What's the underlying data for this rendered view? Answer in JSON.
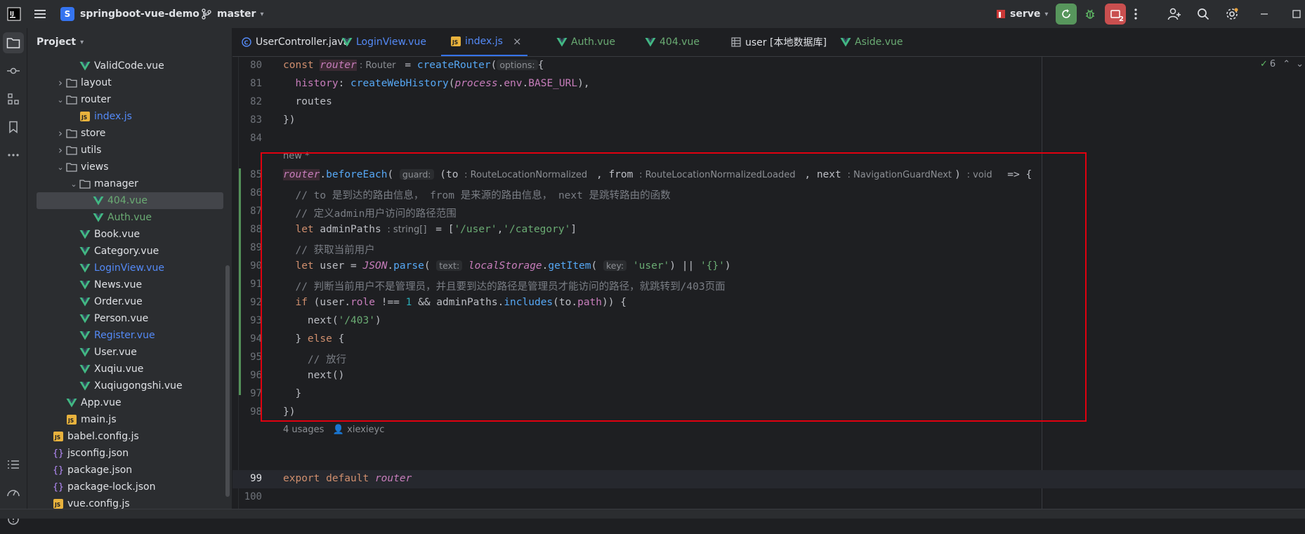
{
  "titlebar": {
    "app_icon": "intellij-logo-icon",
    "project_letter": "S",
    "project_name": "springboot-vue-demo",
    "branch": "master",
    "run_config": "serve",
    "notification_count": "2",
    "accent": "#3574f0"
  },
  "project_panel": {
    "title": "Project",
    "items": [
      {
        "label": "ValidCode.vue",
        "type": "vue",
        "depth": 5,
        "color": "#dfe1e5"
      },
      {
        "label": "layout",
        "type": "folder",
        "depth": 4,
        "chevron": "right"
      },
      {
        "label": "router",
        "type": "folder",
        "depth": 4,
        "chevron": "down"
      },
      {
        "label": "index.js",
        "type": "js",
        "depth": 5,
        "color": "#548af7"
      },
      {
        "label": "store",
        "type": "folder",
        "depth": 4,
        "chevron": "right"
      },
      {
        "label": "utils",
        "type": "folder",
        "depth": 4,
        "chevron": "right"
      },
      {
        "label": "views",
        "type": "folder",
        "depth": 4,
        "chevron": "down"
      },
      {
        "label": "manager",
        "type": "folder",
        "depth": 5,
        "chevron": "down"
      },
      {
        "label": "404.vue",
        "type": "vue",
        "depth": 6,
        "color": "#6aab73",
        "selected": true
      },
      {
        "label": "Auth.vue",
        "type": "vue",
        "depth": 6,
        "color": "#6aab73"
      },
      {
        "label": "Book.vue",
        "type": "vue",
        "depth": 5,
        "color": "#dfe1e5"
      },
      {
        "label": "Category.vue",
        "type": "vue",
        "depth": 5,
        "color": "#dfe1e5"
      },
      {
        "label": "LoginView.vue",
        "type": "vue",
        "depth": 5,
        "color": "#548af7"
      },
      {
        "label": "News.vue",
        "type": "vue",
        "depth": 5,
        "color": "#dfe1e5"
      },
      {
        "label": "Order.vue",
        "type": "vue",
        "depth": 5,
        "color": "#dfe1e5"
      },
      {
        "label": "Person.vue",
        "type": "vue",
        "depth": 5,
        "color": "#dfe1e5"
      },
      {
        "label": "Register.vue",
        "type": "vue",
        "depth": 5,
        "color": "#548af7"
      },
      {
        "label": "User.vue",
        "type": "vue",
        "depth": 5,
        "color": "#dfe1e5"
      },
      {
        "label": "Xuqiu.vue",
        "type": "vue",
        "depth": 5,
        "color": "#dfe1e5"
      },
      {
        "label": "Xuqiugongshi.vue",
        "type": "vue",
        "depth": 5,
        "color": "#dfe1e5"
      },
      {
        "label": "App.vue",
        "type": "vue",
        "depth": 4,
        "color": "#dfe1e5"
      },
      {
        "label": "main.js",
        "type": "js",
        "depth": 4,
        "color": "#dfe1e5"
      },
      {
        "label": "babel.config.js",
        "type": "js",
        "depth": 3,
        "color": "#dfe1e5"
      },
      {
        "label": "jsconfig.json",
        "type": "json",
        "depth": 3,
        "color": "#dfe1e5"
      },
      {
        "label": "package.json",
        "type": "json",
        "depth": 3,
        "color": "#dfe1e5"
      },
      {
        "label": "package-lock.json",
        "type": "json",
        "depth": 3,
        "color": "#dfe1e5"
      },
      {
        "label": "vue.config.js",
        "type": "js",
        "depth": 3,
        "color": "#dfe1e5"
      }
    ]
  },
  "tabs": [
    {
      "label": "UserController.java",
      "icon": "java-class-icon",
      "color": "#dfe1e5"
    },
    {
      "label": "LoginView.vue",
      "icon": "vue-icon",
      "color": "#548af7"
    },
    {
      "label": "index.js",
      "icon": "js-icon",
      "color": "#548af7",
      "active": true
    },
    {
      "label": "Auth.vue",
      "icon": "vue-icon",
      "color": "#6aab73"
    },
    {
      "label": "404.vue",
      "icon": "vue-icon",
      "color": "#6aab73"
    },
    {
      "label": "user [本地数据库]",
      "icon": "table-icon",
      "color": "#dfe1e5"
    },
    {
      "label": "Aside.vue",
      "icon": "vue-icon",
      "color": "#6aab73"
    }
  ],
  "editor": {
    "check_count": "6",
    "new_marker": "new *",
    "usages": "4 usages",
    "author": "xiexieyc",
    "line_numbers": [
      "80",
      "81",
      "82",
      "83",
      "84",
      "85",
      "86",
      "87",
      "88",
      "89",
      "90",
      "91",
      "92",
      "93",
      "94",
      "95",
      "96",
      "97",
      "98",
      "99",
      "100"
    ]
  }
}
